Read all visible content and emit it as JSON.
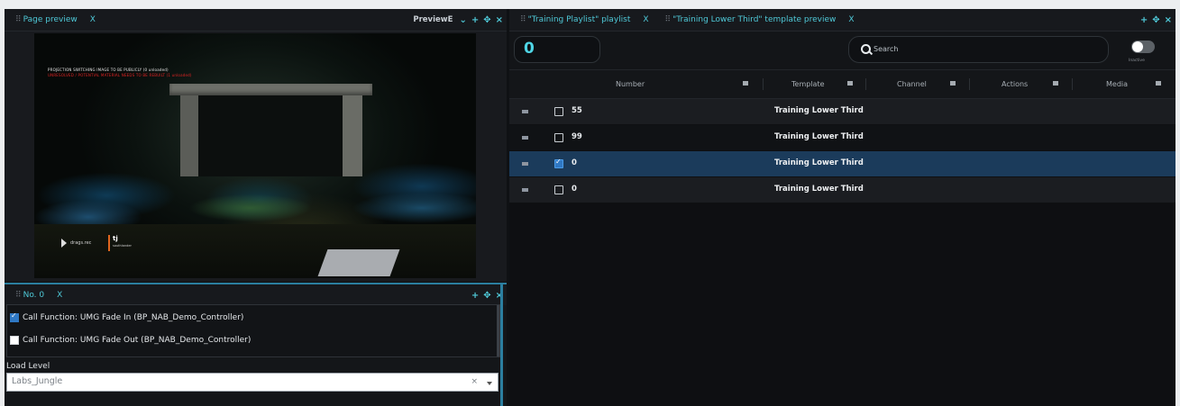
{
  "left_panel": {
    "tab_title": "Page preview",
    "close": "X",
    "preview_dropdown": "PreviewE",
    "scene": {
      "error_line1": "PROJECTION SWITCHING IMAGE TO BE PUBLICLY (0 unloaded)",
      "error_line2": "UNRESOLVED / POTENTIAL MATERIAL NEEDS TO BE REBUILT (1 unloaded)",
      "overlay_small": "drags.rec",
      "lower_third_name": "tj",
      "lower_third_sub": "southlander"
    }
  },
  "details_panel": {
    "tab_title": "No. 0",
    "close": "X",
    "functions": [
      {
        "label": "Call Function: UMG Fade In (BP_NAB_Demo_Controller)",
        "checked": true
      },
      {
        "label": "Call Function: UMG Fade Out (BP_NAB_Demo_Controller)",
        "checked": false
      }
    ],
    "load_level_label": "Load Level",
    "load_level_value": "Labs_Jungle",
    "clear_symbol": "×"
  },
  "right_panel": {
    "tab1_title": "\"Training Playlist\" playlist",
    "tab2_title": "\"Training Lower Third\" template preview",
    "close": "X",
    "number_value": "0",
    "search_placeholder": "Search",
    "toggle_label": "Inactive",
    "columns": [
      "Number",
      "Template",
      "Channel",
      "Actions",
      "Media"
    ],
    "rows": [
      {
        "number": "55",
        "template": "Training Lower Third",
        "checked": false,
        "selected": false
      },
      {
        "number": "99",
        "template": "Training Lower Third",
        "checked": false,
        "selected": false
      },
      {
        "number": "0",
        "template": "Training Lower Third",
        "checked": true,
        "selected": true
      },
      {
        "number": "0",
        "template": "Training Lower Third",
        "checked": false,
        "selected": false
      }
    ]
  },
  "colors": {
    "accent": "#4fc9d8",
    "selected_row": "#1b3b5b",
    "checkbox": "#2f78c4"
  }
}
